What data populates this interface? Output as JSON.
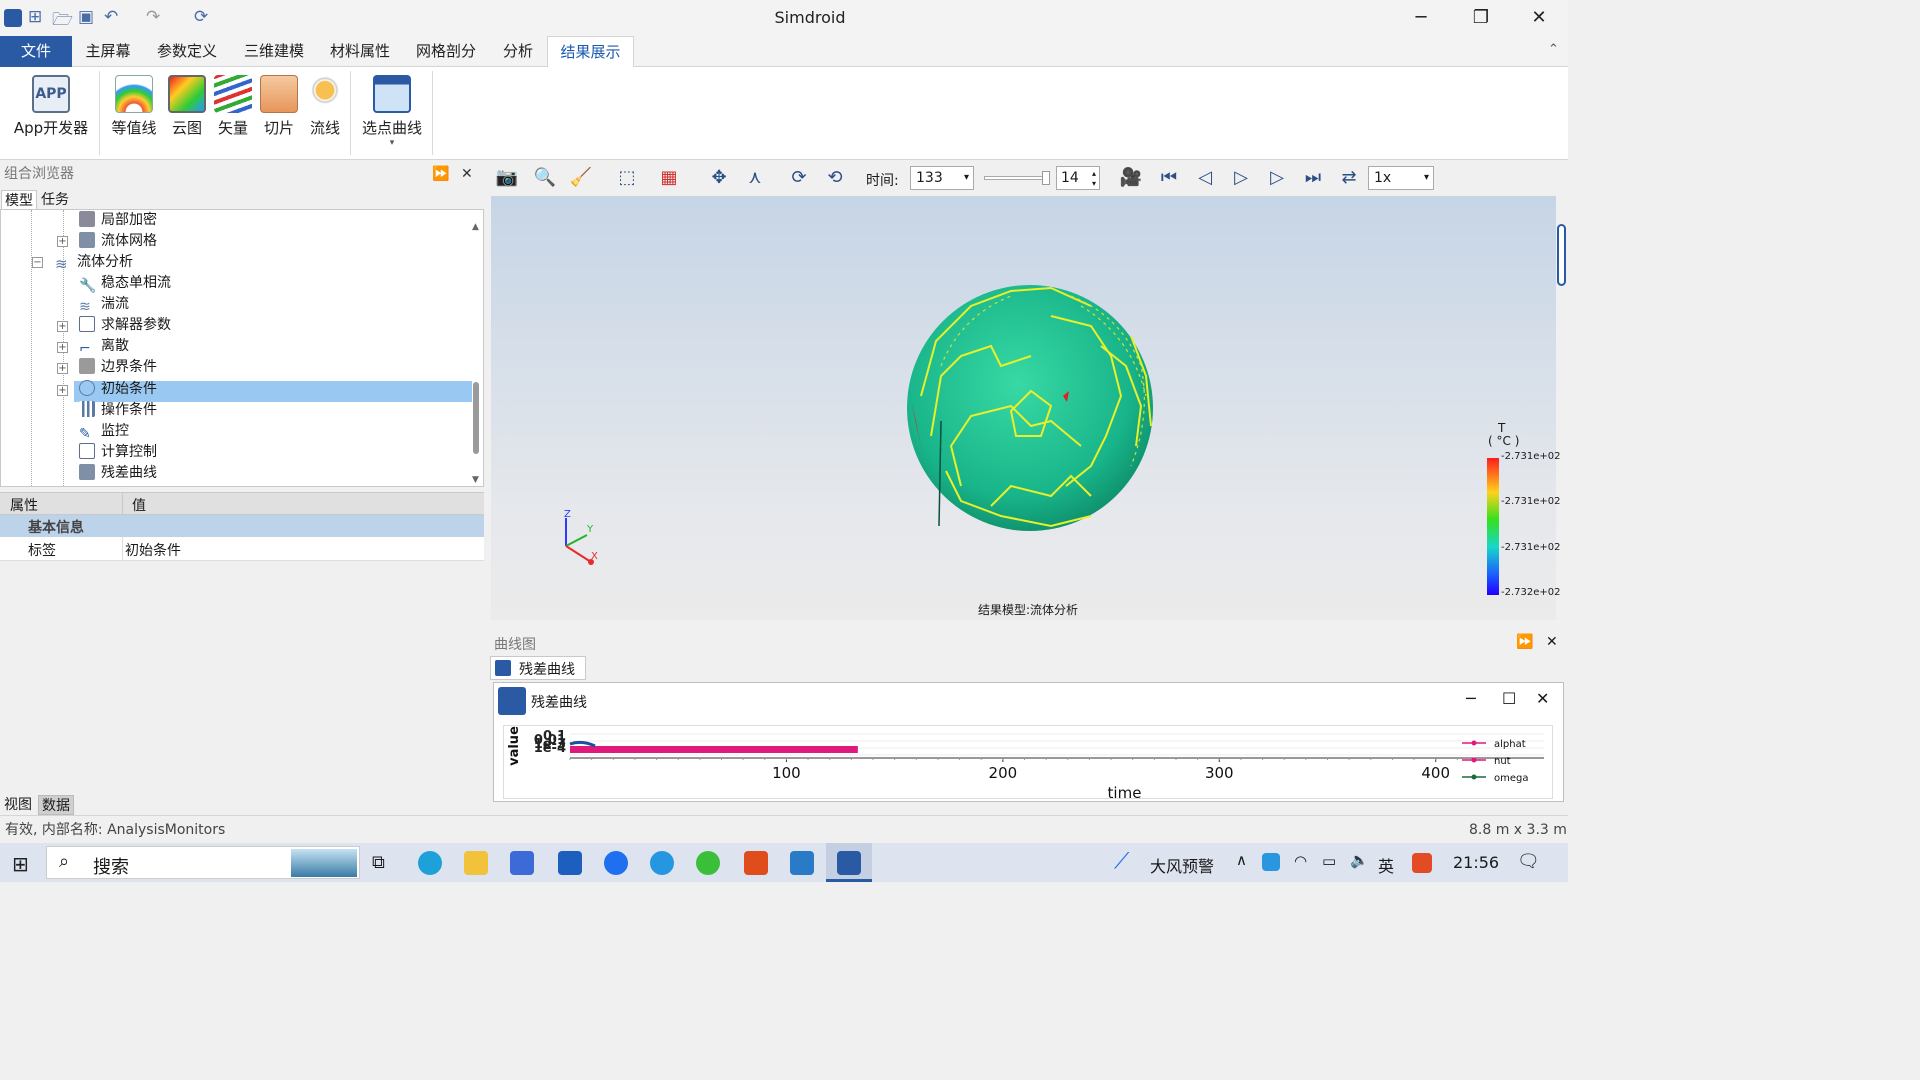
{
  "window": {
    "title": "Simdroid",
    "minimize": "─",
    "restore": "❐",
    "close": "✕"
  },
  "ribbon_tabs": [
    "文件",
    "主屏幕",
    "参数定义",
    "三维建模",
    "材料属性",
    "网格剖分",
    "分析",
    "结果展示"
  ],
  "ribbon_buttons": [
    "App开发器",
    "等值线",
    "云图",
    "矢量",
    "切片",
    "流线",
    "选点曲线"
  ],
  "app_icon_text": "APP",
  "left_panel": {
    "title": "组合浏览器",
    "tabs": [
      "模型",
      "任务"
    ],
    "tree": [
      {
        "label": "局部加密",
        "level": 2,
        "expander": ""
      },
      {
        "label": "流体网格",
        "level": 2,
        "expander": "+"
      },
      {
        "label": "流体分析",
        "level": 1,
        "expander": "−"
      },
      {
        "label": "稳态单相流",
        "level": 2,
        "expander": ""
      },
      {
        "label": "湍流",
        "level": 2,
        "expander": ""
      },
      {
        "label": "求解器参数",
        "level": 2,
        "expander": "+"
      },
      {
        "label": "离散",
        "level": 2,
        "expander": "+"
      },
      {
        "label": "边界条件",
        "level": 2,
        "expander": "+"
      },
      {
        "label": "初始条件",
        "level": 2,
        "expander": "+",
        "selected": true
      },
      {
        "label": "操作条件",
        "level": 2,
        "expander": ""
      },
      {
        "label": "监控",
        "level": 2,
        "expander": ""
      },
      {
        "label": "计算控制",
        "level": 2,
        "expander": ""
      },
      {
        "label": "残差曲线",
        "level": 2,
        "expander": ""
      }
    ],
    "props_headers": [
      "属性",
      "值"
    ],
    "props_group": "基本信息",
    "props_rows": [
      {
        "k": "标签",
        "v": "初始条件"
      }
    ],
    "bottom_tabs": [
      "视图",
      "数据"
    ]
  },
  "viewer": {
    "time_label": "时间:",
    "time_value": "133",
    "frame_value": "14",
    "speed": "1x",
    "model_caption": "结果模型:流体分析",
    "legend": {
      "title": "T",
      "unit": "( °C )",
      "ticks": [
        "-2.731e+02",
        "-2.731e+02",
        "-2.731e+02",
        "-2.732e+02"
      ]
    },
    "axes": {
      "z": "Z",
      "y": "Y",
      "x": "X"
    }
  },
  "curve_panel": {
    "title": "曲线图",
    "tab": "残差曲线",
    "window_title": "残差曲线",
    "chart_data": {
      "type": "line",
      "xlabel": "time",
      "ylabel": "value",
      "x_ticks": [
        "100",
        "200",
        "300",
        "400"
      ],
      "y_ticks_overlapping": [
        "0.1",
        "0.01",
        "1e-3",
        "1e-4"
      ],
      "series": [
        {
          "name": "alphat",
          "color": "#e0197d"
        },
        {
          "name": "nut",
          "color": "#e0197d"
        },
        {
          "name": "omega",
          "color": "#1a6b3a"
        }
      ],
      "x_range": [
        0,
        420
      ],
      "data_end_x": 133
    }
  },
  "status": {
    "left": "有效, 内部名称: AnalysisMonitors",
    "right": "8.8 m x 3.3 m"
  },
  "taskbar": {
    "search": "搜索",
    "weather": "大风预警",
    "lang": "英",
    "time": "21:56"
  }
}
